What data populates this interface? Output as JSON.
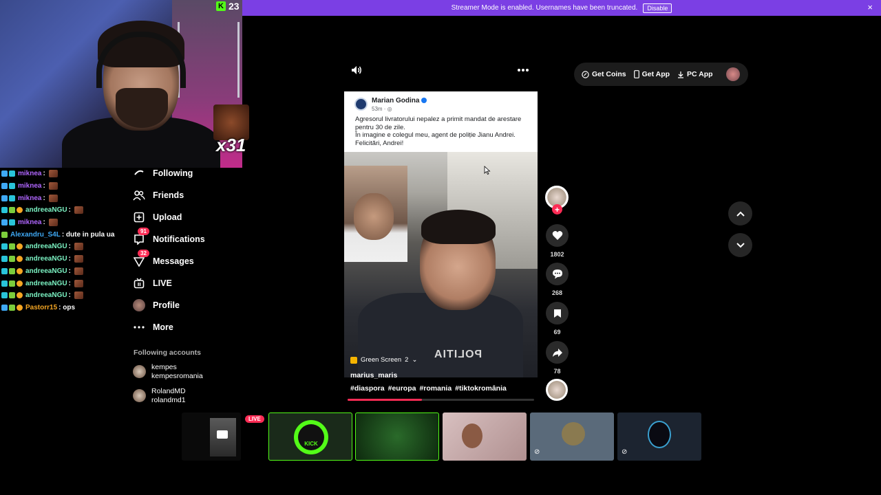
{
  "banner": {
    "message": "Streamer Mode is enabled. Usernames have been truncated.",
    "disable_label": "Disable",
    "close_icon": "×"
  },
  "overlay": {
    "kick_count": "23",
    "kick_logo": "K",
    "combo_text": "x31"
  },
  "chat": [
    {
      "user": "miknea",
      "color": "#b066ff",
      "badges": [
        "b1",
        "b2"
      ],
      "msg": ":",
      "emote": true
    },
    {
      "user": "miknea",
      "color": "#b066ff",
      "badges": [
        "b1",
        "b2"
      ],
      "msg": ":",
      "emote": true
    },
    {
      "user": "miknea",
      "color": "#b066ff",
      "badges": [
        "b1",
        "b2"
      ],
      "msg": ":",
      "emote": true
    },
    {
      "user": "andreeaNGU",
      "color": "#7cf4c4",
      "badges": [
        "b2",
        "b4",
        "b3"
      ],
      "msg": ":",
      "emote": true
    },
    {
      "user": "miknea",
      "color": "#b066ff",
      "badges": [
        "b1",
        "b2"
      ],
      "msg": ":",
      "emote": true
    },
    {
      "user": "Alexandru_S4L",
      "color": "#3fa9f5",
      "badges": [
        "b4"
      ],
      "msg": ": dute in pula ua",
      "emote": false
    },
    {
      "user": "andreeaNGU",
      "color": "#7cf4c4",
      "badges": [
        "b2",
        "b4",
        "b3"
      ],
      "msg": ":",
      "emote": true
    },
    {
      "user": "andreeaNGU",
      "color": "#7cf4c4",
      "badges": [
        "b2",
        "b4",
        "b3"
      ],
      "msg": ":",
      "emote": true
    },
    {
      "user": "andreeaNGU",
      "color": "#7cf4c4",
      "badges": [
        "b2",
        "b4",
        "b3"
      ],
      "msg": ":",
      "emote": true
    },
    {
      "user": "andreeaNGU",
      "color": "#7cf4c4",
      "badges": [
        "b2",
        "b4",
        "b3"
      ],
      "msg": ":",
      "emote": true
    },
    {
      "user": "andreeaNGU",
      "color": "#7cf4c4",
      "badges": [
        "b2",
        "b4",
        "b3"
      ],
      "msg": ":",
      "emote": true
    },
    {
      "user": "Pastorr15",
      "color": "#f5a623",
      "badges": [
        "b1",
        "b4",
        "b3"
      ],
      "msg": ": ops",
      "emote": false
    }
  ],
  "sidebar": {
    "items": [
      {
        "label": "Following",
        "icon": "following-icon"
      },
      {
        "label": "Friends",
        "icon": "friends-icon"
      },
      {
        "label": "Upload",
        "icon": "upload-icon"
      },
      {
        "label": "Notifications",
        "icon": "notifications-icon",
        "badge": "91"
      },
      {
        "label": "Messages",
        "icon": "messages-icon",
        "badge": "32"
      },
      {
        "label": "LIVE",
        "icon": "live-icon"
      },
      {
        "label": "Profile",
        "icon": "profile-avatar"
      },
      {
        "label": "More",
        "icon": "more-icon"
      }
    ],
    "following_title": "Following accounts",
    "accounts": [
      {
        "name": "kempes",
        "handle": "kempesromania"
      },
      {
        "name": "RolandMD",
        "handle": "rolandmd1"
      }
    ]
  },
  "video": {
    "post_author": "Marian Godina",
    "post_time": "53m · ",
    "post_text_1": "Agresorul livratorului nepalez a primit mandat de arestare pentru 30 de zile.",
    "post_text_2": "În imagine e colegul meu, agent de poliție Jianu Andrei. Felicitări, Andrei!",
    "vest_text": "POLITIA",
    "effect_label": "Green Screen",
    "effect_count": "2",
    "author": "marius_maris",
    "hashtags": [
      "#diaspora",
      "#europa",
      "#romania",
      "#tiktokromânia"
    ],
    "progress": 0.4
  },
  "actions": {
    "likes": "1802",
    "comments": "268",
    "saves": "69",
    "shares": "78",
    "follow_plus": "+"
  },
  "top_pill": {
    "coins": "Get Coins",
    "app": "Get App",
    "pc_app": "PC App"
  },
  "scenes": {
    "live_label": "LIVE",
    "kick_label": "KICK"
  },
  "colors": {
    "accent": "#fe2c55",
    "banner": "#7b3fe4",
    "kick_green": "#53fc18"
  }
}
